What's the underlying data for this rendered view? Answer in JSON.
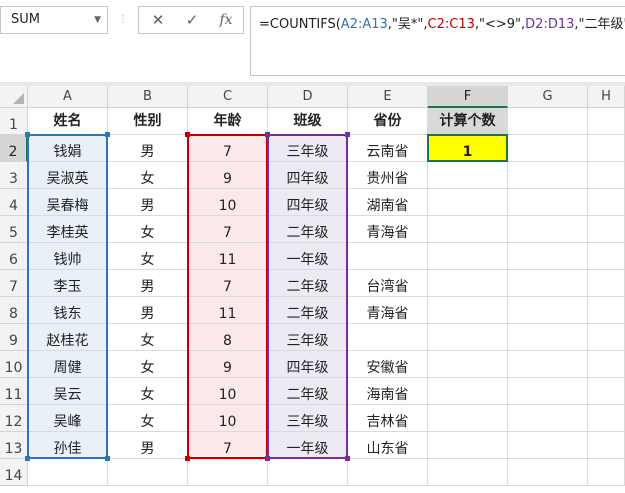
{
  "name_box": {
    "value": "SUM"
  },
  "formula_bar": {
    "cancel_glyph": "✕",
    "enter_glyph": "✓",
    "fx_label": "fx",
    "parts": [
      {
        "text": "=COUNTIFS(",
        "color": "#222222"
      },
      {
        "text": "A2:A13",
        "color": "#2e75b6"
      },
      {
        "text": ",\"吴*\",",
        "color": "#222222"
      },
      {
        "text": "C2:C13",
        "color": "#c00000"
      },
      {
        "text": ",\"<>9\",",
        "color": "#222222"
      },
      {
        "text": "D2:D13",
        "color": "#7030a0"
      },
      {
        "text": ",\"二年级\")",
        "color": "#222222"
      }
    ]
  },
  "colors": {
    "range_a": "#2e75b6",
    "range_c": "#c00000",
    "range_d": "#7030a0",
    "result_fill": "#ffff00",
    "header_fill_f": "#d9d9d9",
    "active_cell": "#217346"
  },
  "columns": [
    "A",
    "B",
    "C",
    "D",
    "E",
    "F",
    "G",
    "H"
  ],
  "rows": [
    "1",
    "2",
    "3",
    "4",
    "5",
    "6",
    "7",
    "8",
    "9",
    "10",
    "11",
    "12",
    "13",
    "14"
  ],
  "header": [
    "姓名",
    "性别",
    "年龄",
    "班级",
    "省份",
    "计算个数"
  ],
  "records": [
    [
      "钱娟",
      "男",
      "7",
      "三年级",
      "云南省"
    ],
    [
      "吴淑英",
      "女",
      "9",
      "四年级",
      "贵州省"
    ],
    [
      "吴春梅",
      "男",
      "10",
      "四年级",
      "湖南省"
    ],
    [
      "李桂英",
      "女",
      "7",
      "二年级",
      "青海省"
    ],
    [
      "钱帅",
      "女",
      "11",
      "一年级",
      ""
    ],
    [
      "李玉",
      "男",
      "7",
      "二年级",
      "台湾省"
    ],
    [
      "钱东",
      "男",
      "11",
      "二年级",
      "青海省"
    ],
    [
      "赵桂花",
      "女",
      "8",
      "三年级",
      ""
    ],
    [
      "周健",
      "女",
      "9",
      "四年级",
      "安徽省"
    ],
    [
      "吴云",
      "女",
      "10",
      "二年级",
      "海南省"
    ],
    [
      "吴峰",
      "女",
      "10",
      "三年级",
      "吉林省"
    ],
    [
      "孙佳",
      "男",
      "7",
      "一年级",
      "山东省"
    ]
  ],
  "result": {
    "value": "1"
  }
}
